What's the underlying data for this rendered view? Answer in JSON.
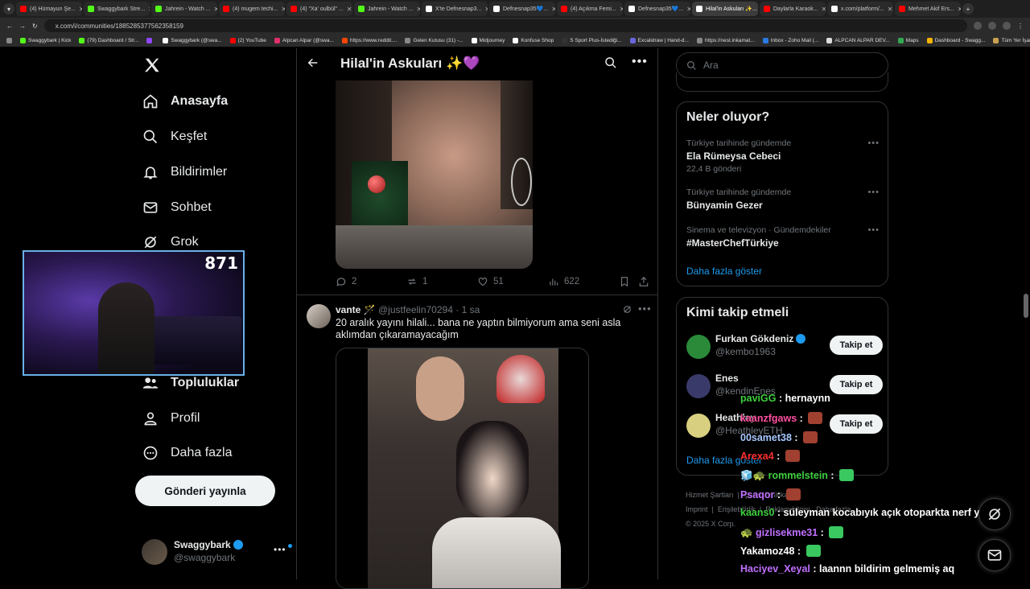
{
  "browser": {
    "tabs": [
      {
        "label": "(4) Hümayun Şe...",
        "color": "#ff0000",
        "active": false
      },
      {
        "label": "Swaggybark Stre...",
        "color": "#53fc18",
        "active": false
      },
      {
        "label": "Jahrein - Watch ...",
        "color": "#53fc18",
        "active": false
      },
      {
        "label": "(4) mugem techi...",
        "color": "#ff0000",
        "active": false
      },
      {
        "label": "(4) \"Xa' oulbül\" ...",
        "color": "#ff0000",
        "active": false
      },
      {
        "label": "Jahrein - Watch ...",
        "color": "#53fc18",
        "active": false
      },
      {
        "label": "X'te Defnesnap3...",
        "color": "#ffffff",
        "active": false
      },
      {
        "label": "Defnesnap35💙...",
        "color": "#ffffff",
        "active": false
      },
      {
        "label": "(4) Açıkma Femi...",
        "color": "#ff0000",
        "active": false
      },
      {
        "label": "Defnesnap35💙...",
        "color": "#ffffff",
        "active": false
      },
      {
        "label": "Hilal'in Askuları ✨...",
        "color": "#ffffff",
        "active": true
      },
      {
        "label": "Daylarla Karaok...",
        "color": "#ff0000",
        "active": false
      },
      {
        "label": "x.com/platform/...",
        "color": "#ffffff",
        "active": false
      },
      {
        "label": "Mehmet Akif Ers...",
        "color": "#ff0000",
        "active": false
      }
    ],
    "url": "x.com/i/communities/1885285377562358159",
    "bookmarks": [
      {
        "label": "Swaggybark | Kick",
        "color": "#53fc18"
      },
      {
        "label": "(79) Dashboard / Str...",
        "color": "#53fc18"
      },
      {
        "label": "",
        "color": "#9146ff"
      },
      {
        "label": "Swaggybark (@swa...",
        "color": "#ffffff"
      },
      {
        "label": "(2) YouTube",
        "color": "#ff0000"
      },
      {
        "label": "Alpcan Alpar (@swa...",
        "color": "#e1306c"
      },
      {
        "label": "https://www.reddit....",
        "color": "#ff4500"
      },
      {
        "label": "Gelen Kutusu (31) -...",
        "color": "#888888"
      },
      {
        "label": "Midjourney",
        "color": "#ffffff"
      },
      {
        "label": "Konfuse Shop",
        "color": "#ffffff"
      },
      {
        "label": "S Sport Plus-İstediği...",
        "color": "#333333"
      },
      {
        "label": "Excalidraw | Hand-d...",
        "color": "#6965db"
      },
      {
        "label": "https://nest.inkamat...",
        "color": "#888888"
      },
      {
        "label": "Inbox - Zoho Mail (...",
        "color": "#2a7ae2"
      },
      {
        "label": "ALPCAN ALPAR DEV...",
        "color": "#dddddd"
      },
      {
        "label": "Maps",
        "color": "#34a853"
      },
      {
        "label": "Dashboard - Swagg...",
        "color": "#f4b400"
      }
    ],
    "all_bookmarks": "Tüm Yer İşaretleri"
  },
  "sidebar": {
    "nav": [
      {
        "label": "Anasayfa",
        "icon": "home-icon"
      },
      {
        "label": "Keşfet",
        "icon": "search-icon"
      },
      {
        "label": "Bildirimler",
        "icon": "bell-icon"
      },
      {
        "label": "Sohbet",
        "icon": "mail-icon"
      },
      {
        "label": "Grok",
        "icon": "grok-icon"
      },
      {
        "label": "Topluluklar",
        "icon": "communities-icon"
      },
      {
        "label": "Profil",
        "icon": "profile-icon"
      },
      {
        "label": "Daha fazla",
        "icon": "more-icon"
      }
    ],
    "post_button": "Gönderi yayınla",
    "account": {
      "name": "Swaggybark",
      "handle": "@swaggybark"
    }
  },
  "webcam": {
    "viewer_count": "871"
  },
  "main": {
    "title": "Hilal'in Askuları ✨💜",
    "tweet1": {
      "replies": "2",
      "reposts": "1",
      "likes": "51",
      "views": "622"
    },
    "tweet2": {
      "name": "vante 🪄",
      "handle": "@justfeelin70294",
      "time": "· 1 sa",
      "text": "20 aralık yayını hilali... bana ne yaptın bilmiyorum ama seni asla aklımdan çıkaramayacağım"
    }
  },
  "right": {
    "search_placeholder": "Ara",
    "trends_title": "Neler oluyor?",
    "trends": [
      {
        "context": "Türkiye tarihinde gündemde",
        "title": "Ela Rümeysa Cebeci",
        "count": "22,4 B gönderi"
      },
      {
        "context": "Türkiye tarihinde gündemde",
        "title": "Bünyamin Gezer",
        "count": ""
      },
      {
        "context": "Sinema ve televizyon · Gündemdekiler",
        "title": "#MasterChefTürkiye",
        "count": ""
      }
    ],
    "trends_more": "Daha fazla göster",
    "who_title": "Kimi takip etmeli",
    "who": [
      {
        "name": "Furkan Gökdeniz",
        "handle": "@kembo1963",
        "verified": true,
        "color": "#2a8a3a"
      },
      {
        "name": "Enes",
        "handle": "@kendinEnes",
        "verified": false,
        "color": "#3a3a6a"
      },
      {
        "name": "Heathley",
        "handle": "@HeathleyETH",
        "verified": false,
        "color": "#d8d080"
      }
    ],
    "follow_label": "Takip et",
    "who_more": "Daha fazla göster",
    "footer": [
      "Hizmet Şartları",
      "Çerez Politikası",
      "Imprint",
      "Erişilebilirlik",
      "Reklam bilgisi",
      "Daha fazla ...",
      "© 2025 X Corp."
    ]
  },
  "chat": [
    {
      "user": "paviGG",
      "color": "#3ecf3e",
      "text": "hernaynn",
      "emote": ""
    },
    {
      "user": "kaanzfgaws",
      "color": "#ff4fa0",
      "text": "",
      "emote": "#a04030"
    },
    {
      "user": "00samet38",
      "color": "#a8c8ff",
      "text": "",
      "emote": "#a04030"
    },
    {
      "user": "Arexa4",
      "color": "#ff3030",
      "text": "",
      "emote": "#a04030"
    },
    {
      "user": "rommelstein",
      "color": "#3ecf3e",
      "text": "",
      "emote": "#3ac860",
      "prefix": "🧊🐢"
    },
    {
      "user": "Psaqor",
      "color": "#c070ff",
      "text": "",
      "emote": "#a04030"
    },
    {
      "user": "kaans0",
      "color": "#3ecf3e",
      "text": "süleyman kocabıyık açık otoparkta nerf yiyor",
      "emote": ""
    },
    {
      "user": "gizlisekme31",
      "color": "#c070ff",
      "text": "",
      "emote": "#3ac860",
      "prefix": "🐢"
    },
    {
      "user": "Yakamoz48",
      "color": "#ffffff",
      "text": "",
      "emote": "#3ac860"
    },
    {
      "user": "Haciyev_Xeyal",
      "color": "#c070ff",
      "text": "laannn bildirim gelmemiş aq",
      "emote": ""
    }
  ]
}
